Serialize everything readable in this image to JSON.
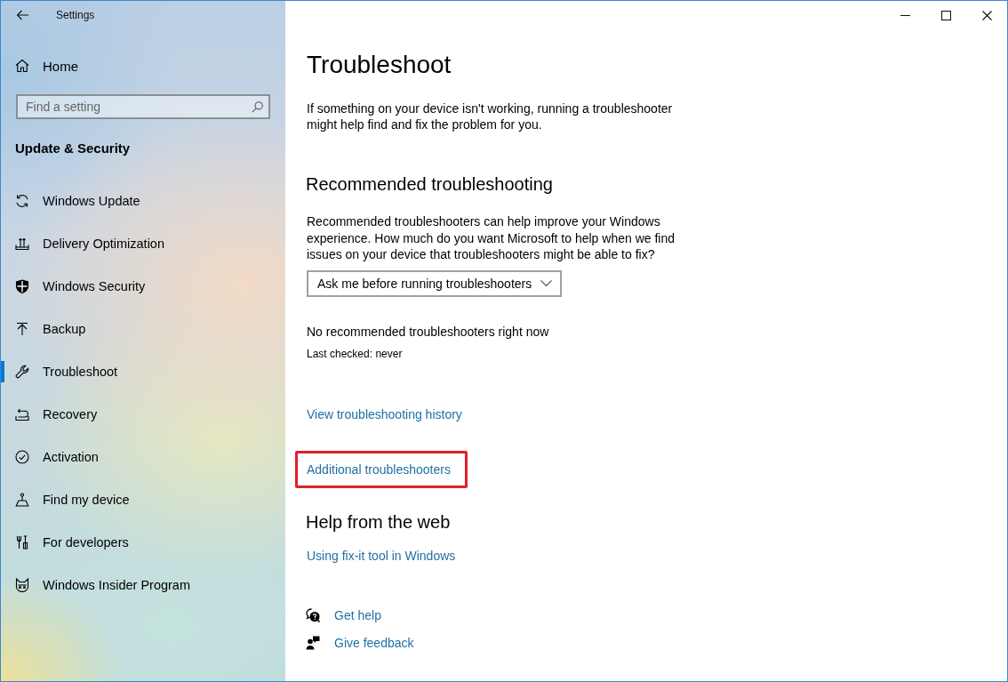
{
  "window": {
    "title": "Settings"
  },
  "sidebar": {
    "home": "Home",
    "search": {
      "placeholder": "Find a setting"
    },
    "section_title": "Update & Security",
    "items": [
      {
        "label": "Windows Update",
        "selected": false
      },
      {
        "label": "Delivery Optimization",
        "selected": false
      },
      {
        "label": "Windows Security",
        "selected": false
      },
      {
        "label": "Backup",
        "selected": false
      },
      {
        "label": "Troubleshoot",
        "selected": true
      },
      {
        "label": "Recovery",
        "selected": false
      },
      {
        "label": "Activation",
        "selected": false
      },
      {
        "label": "Find my device",
        "selected": false
      },
      {
        "label": "For developers",
        "selected": false
      },
      {
        "label": "Windows Insider Program",
        "selected": false
      }
    ]
  },
  "content": {
    "title": "Troubleshoot",
    "intro": "If something on your device isn't working, running a troubleshooter might help find and fix the problem for you.",
    "recommended": {
      "heading": "Recommended troubleshooting",
      "description": "Recommended troubleshooters can help improve your Windows experience. How much do you want Microsoft to help when we find issues on your device that troubleshooters might be able to fix?",
      "dropdown": {
        "value": "Ask me before running troubleshooters"
      },
      "status": "No recommended troubleshooters right now",
      "last_checked": "Last checked: never"
    },
    "links": [
      {
        "text": "View troubleshooting history",
        "highlighted": false
      },
      {
        "text": "Additional troubleshooters",
        "highlighted": true
      }
    ],
    "help_from_web": {
      "heading": "Help from the web",
      "links": [
        "Using fix-it tool in Windows"
      ]
    },
    "support_links": [
      "Get help",
      "Give feedback"
    ]
  }
}
